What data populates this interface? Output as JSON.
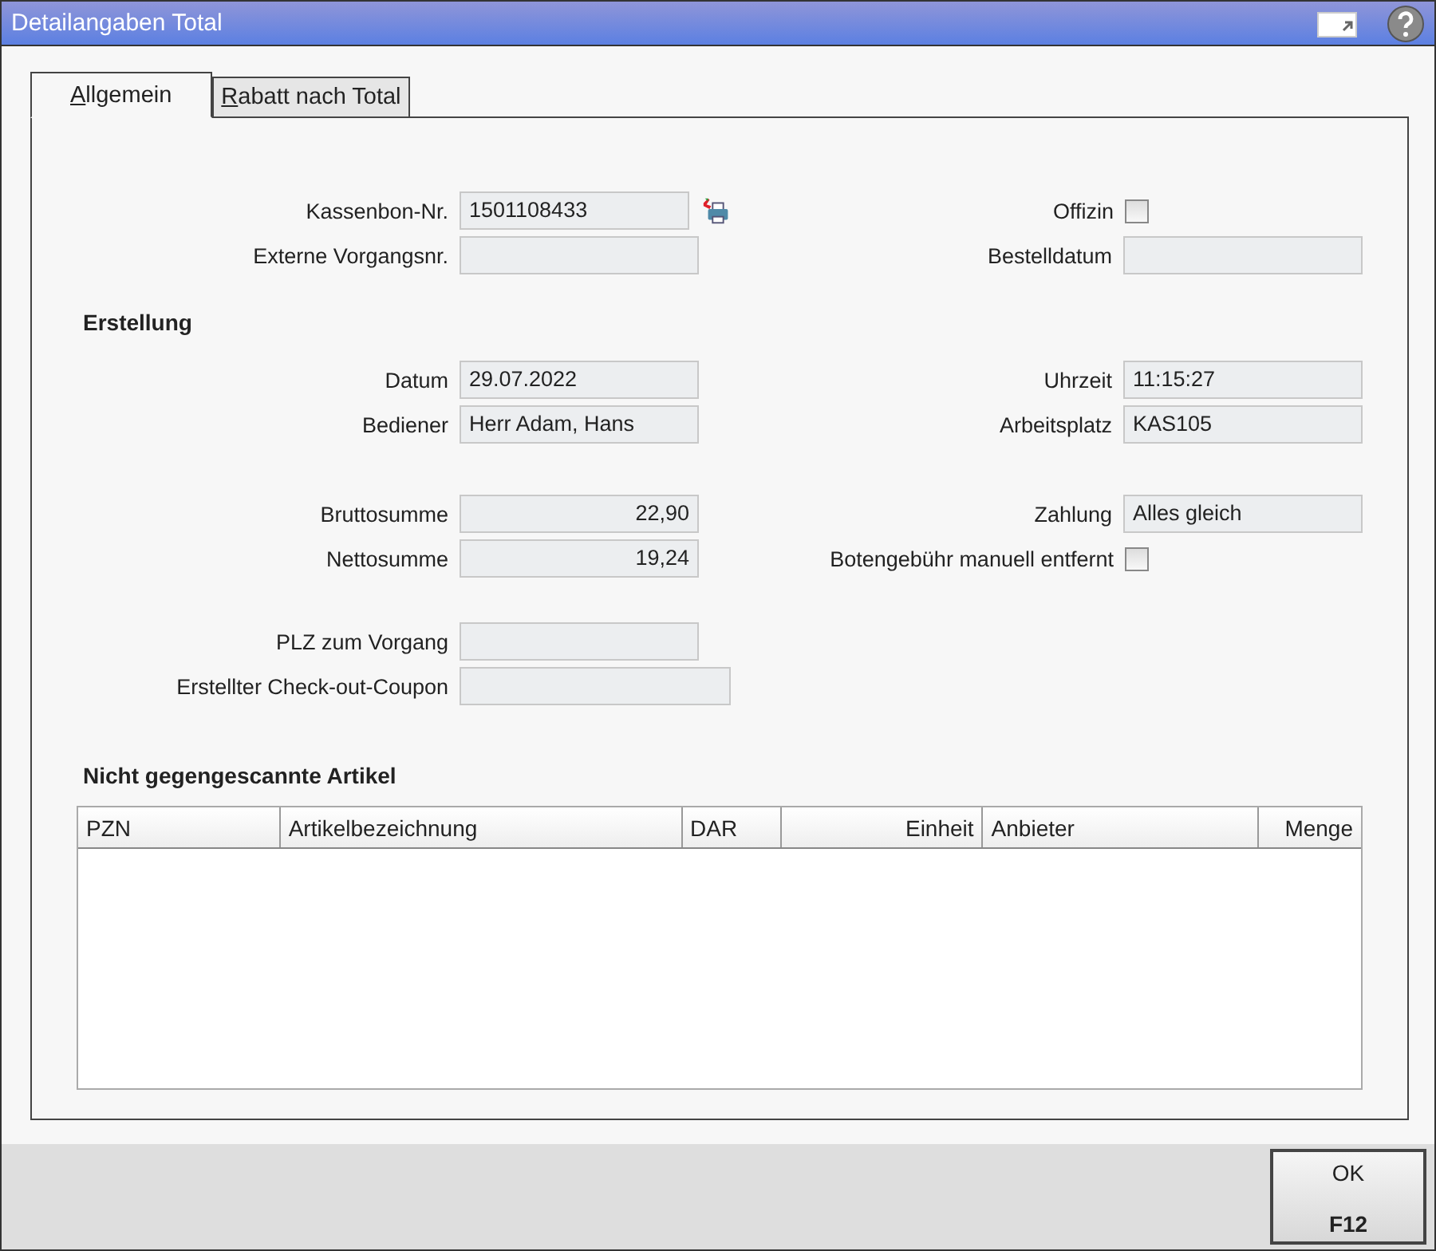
{
  "window": {
    "title": "Detailangaben Total"
  },
  "tabs": [
    {
      "label": "Allgemein",
      "selected": true
    },
    {
      "label": "Rabatt nach Total",
      "selected": false
    }
  ],
  "groups": [
    {
      "rows": [
        {
          "left": {
            "label": "Kassenbon-Nr.",
            "kind": "field-print",
            "value": "1501108433"
          },
          "right": {
            "label": "Offizin",
            "kind": "checkbox",
            "checked": false
          }
        },
        {
          "left": {
            "label": "Externe Vorgangsnr.",
            "kind": "field"
          },
          "right": {
            "label": "Bestelldatum",
            "kind": "field"
          }
        }
      ]
    },
    {
      "heading": "Erstellung",
      "rows": [
        {
          "left": {
            "label": "Datum",
            "kind": "field",
            "value": "29.07.2022"
          },
          "right": {
            "label": "Uhrzeit",
            "kind": "field",
            "value": "11:15:27"
          }
        },
        {
          "left": {
            "label": "Bediener",
            "kind": "field",
            "value": "Herr Adam, Hans"
          },
          "right": {
            "label": "Arbeitsplatz",
            "kind": "field",
            "value": "KAS105"
          }
        }
      ]
    },
    {
      "rows": [
        {
          "left": {
            "label": "Bruttosumme",
            "kind": "amount",
            "value": "22,90"
          },
          "right": {
            "label": "Zahlung",
            "kind": "field",
            "value": "Alles gleich"
          }
        },
        {
          "left": {
            "label": "Nettosumme",
            "kind": "amount",
            "value": "19,24"
          },
          "right": {
            "label": "Botengebühr manuell entfernt",
            "kind": "checkbox",
            "checked": false
          }
        }
      ]
    },
    {
      "rows": [
        {
          "left": {
            "label": "PLZ zum Vorgang",
            "kind": "field"
          }
        },
        {
          "left": {
            "label": "Erstellter Check-out-Coupon",
            "kind": "wide"
          }
        }
      ]
    }
  ],
  "table": {
    "title": "Nicht gegengescannte Artikel",
    "columns": [
      {
        "label": "PZN",
        "kind": "text"
      },
      {
        "label": "Artikelbezeichnung",
        "kind": "text"
      },
      {
        "label": "DAR",
        "kind": "text"
      },
      {
        "label": "Einheit",
        "kind": "number"
      },
      {
        "label": "Anbieter",
        "kind": "text"
      },
      {
        "label": "Menge",
        "kind": "number"
      }
    ]
  },
  "buttons": [
    {
      "label": "OK",
      "key": "F12"
    }
  ]
}
